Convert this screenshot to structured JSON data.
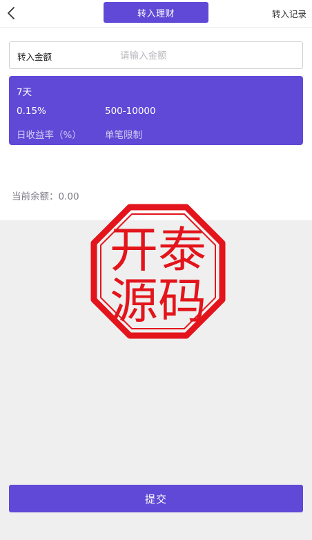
{
  "header": {
    "title": "转入理财",
    "records_label": "转入记录"
  },
  "amount": {
    "label": "转入金额",
    "placeholder": "请输入金额",
    "value": ""
  },
  "plan": {
    "days": "7天",
    "rate": "0.15%",
    "limit": "500-10000",
    "rate_label": "日收益率（%）",
    "limit_label": "单笔限制"
  },
  "balance": {
    "label": "当前余额：",
    "value": "0.00"
  },
  "watermark": {
    "line1": "开泰",
    "line2": "源码"
  },
  "submit_label": "提交",
  "colors": {
    "accent": "#5f49d6",
    "stamp": "#e3141b"
  },
  "icons": {
    "back": "chevron-left-icon"
  }
}
